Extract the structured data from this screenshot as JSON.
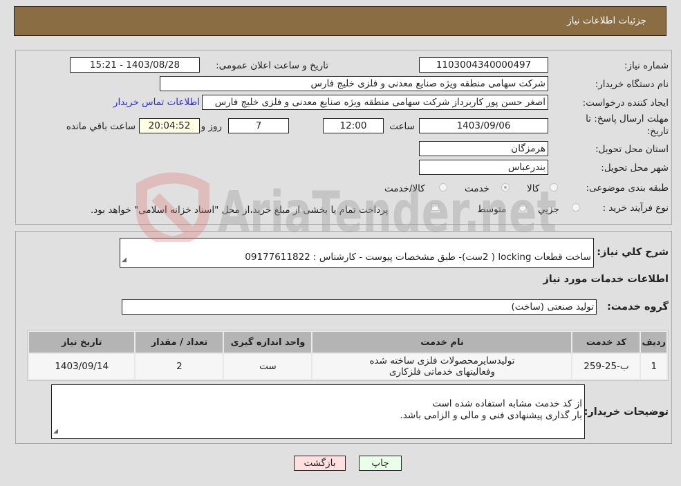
{
  "header": {
    "title": "جزئیات اطلاعات نیاز"
  },
  "fields": {
    "need_number": {
      "label": "شماره نیاز:",
      "value": "1103004340000497"
    },
    "announce_datetime": {
      "label": "تاریخ و ساعت اعلان عمومی:",
      "value": "1403/08/28 - 15:21"
    },
    "buyer_org": {
      "label": "نام دستگاه خریدار:",
      "value": "شرکت سهامی منطقه ویژه صنایع معدنی و فلزی خلیج فارس"
    },
    "requester": {
      "label": "ایجاد کننده درخواست:",
      "value": "اصغر حسن پور کاربرداز شرکت سهامی منطقه ویژه صنایع معدنی و فلزی خلیج فارس"
    },
    "buyer_contact_link": "اطلاعات تماس خریدار",
    "deadline": {
      "label_line1": "مهلت ارسال پاسخ: تا",
      "label_line2": "تاریخ:",
      "date": "1403/09/06",
      "time_label": "ساعت",
      "time": "12:00",
      "days": "7",
      "days_label": "روز و",
      "remaining": "20:04:52",
      "remaining_label": "ساعت باقي مانده"
    },
    "province": {
      "label": "استان محل تحویل:",
      "value": "هرمزگان"
    },
    "city": {
      "label": "شهر محل تحویل:",
      "value": "بندرعباس"
    },
    "category": {
      "label": "طبقه بندی موضوعی:",
      "options": [
        "کالا",
        "خدمت",
        "کالا/خدمت"
      ],
      "selected": "خدمت"
    },
    "purchase_type": {
      "label": "نوع فرآیند خرید :",
      "options": [
        "جزيي",
        "متوسط"
      ],
      "selected": null,
      "treasury_checkbox_label": "پرداخت تمام یا بخشی از مبلغ خرید،از محل \"اسناد خزانه اسلامی\" خواهد بود.",
      "treasury_checked": false
    }
  },
  "description": {
    "label": "شرح کلي نياز:",
    "value": "ساخت قطعات  locking ( 2ست)-  طبق مشخصات پیوست - کارشناس : 09177611822"
  },
  "services_section_title": "اطلاعات خدمات مورد نیاز",
  "service_group": {
    "label": "گروه خدمت:",
    "value": "تولید صنعتی (ساخت)"
  },
  "table": {
    "columns": [
      "ردیف",
      "کد خدمت",
      "نام خدمت",
      "واحد اندازه گیری",
      "تعداد / مقدار",
      "تاریخ نیاز"
    ],
    "rows": [
      {
        "row": "1",
        "code": "ب-25-259",
        "name": "تولیدسایرمحصولات فلزی ساخته شده وفعالیتهای خدماتی فلزکاری",
        "unit": "ست",
        "qty": "2",
        "date": "1403/09/14"
      }
    ]
  },
  "buyer_notes": {
    "label": "توضیحات خریدار:",
    "value": "از کد خدمت مشابه استفاده شده است\nبار گذاری پیشنهادی فنی و مالی و الزامی باشد."
  },
  "buttons": {
    "print": "چاپ",
    "back": "بازگشت"
  },
  "watermark": {
    "text": "AriaTender.net"
  },
  "colors": {
    "header": "#8b6d43",
    "print_bg": "#eaffea",
    "back_bg": "#ffe0e0",
    "link": "#2a2ad6"
  }
}
